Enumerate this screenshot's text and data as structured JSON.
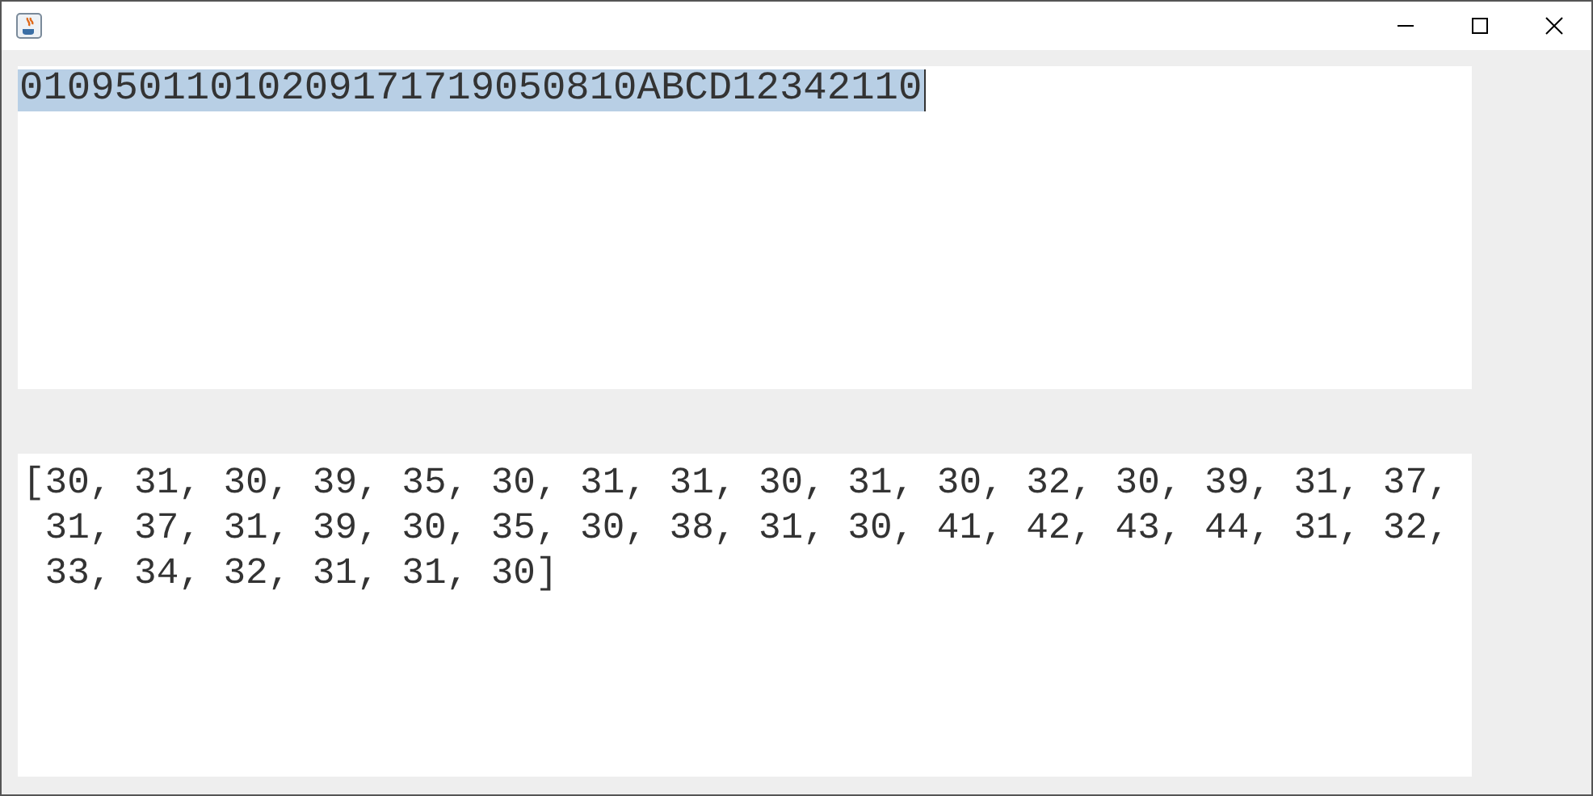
{
  "input_area": {
    "value": "01095011010209171719050810ABCD12342110",
    "selected": true
  },
  "output_area": {
    "lines": [
      "[30, 31, 30, 39, 35, 30, 31, 31, 30, 31, 30, 32, 30, 39, 31, 37,",
      " 31, 37, 31, 39, 30, 35, 30, 38, 31, 30, 41, 42, 43, 44, 31, 32,",
      " 33, 34, 32, 31, 31, 30]"
    ]
  }
}
